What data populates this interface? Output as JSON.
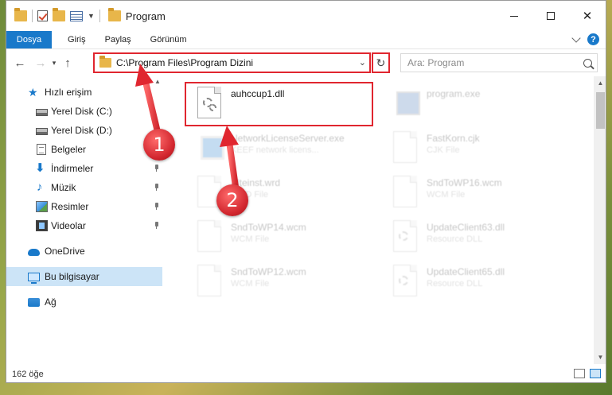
{
  "window": {
    "title": "Program"
  },
  "ribbon": {
    "tabs": [
      {
        "label": "Dosya",
        "active": true
      },
      {
        "label": "Giriş"
      },
      {
        "label": "Paylaş"
      },
      {
        "label": "Görünüm"
      }
    ],
    "help": "?"
  },
  "address": {
    "path": "C:\\Program Files\\Program Dizini",
    "search_placeholder": "Ara: Program"
  },
  "sidebar": {
    "items": [
      {
        "label": "Hızlı erişim",
        "icon": "star-icon"
      },
      {
        "label": "Yerel Disk (C:)",
        "icon": "drive-icon"
      },
      {
        "label": "Yerel Disk (D:)",
        "icon": "drive-icon"
      },
      {
        "label": "Belgeler",
        "icon": "documents-icon"
      },
      {
        "label": "İndirmeler",
        "icon": "download-icon",
        "pinned": true
      },
      {
        "label": "Müzik",
        "icon": "music-icon",
        "pinned": true
      },
      {
        "label": "Resimler",
        "icon": "pictures-icon",
        "pinned": true
      },
      {
        "label": "Videolar",
        "icon": "videos-icon",
        "pinned": true
      },
      {
        "label": "OneDrive",
        "icon": "onedrive-icon"
      },
      {
        "label": "Bu bilgisayar",
        "icon": "this-pc-icon",
        "selected": true
      },
      {
        "label": "Ağ",
        "icon": "network-icon"
      }
    ]
  },
  "files": [
    {
      "name": "auhccup1.dll",
      "desc": "",
      "highlighted": true
    },
    {
      "name": "program.exe",
      "desc": ""
    },
    {
      "name": "NetworkLicenseServer.exe",
      "desc": "KEEF network licens..."
    },
    {
      "name": "FastKorn.cjk",
      "desc": "CJK File"
    },
    {
      "name": "Alteinst.wrd",
      "desc": "WRD File"
    },
    {
      "name": "SndToWP16.wcm",
      "desc": "WCM File"
    },
    {
      "name": "SndToWP14.wcm",
      "desc": "WCM File"
    },
    {
      "name": "UpdateClient63.dll",
      "desc": "Resource DLL"
    },
    {
      "name": "SndToWP12.wcm",
      "desc": "WCM File"
    },
    {
      "name": "UpdateClient65.dll",
      "desc": "Resource DLL"
    }
  ],
  "status": {
    "item_count": "162 öğe"
  },
  "annotations": {
    "step1": "1",
    "step2": "2",
    "color": "#e0262f"
  }
}
